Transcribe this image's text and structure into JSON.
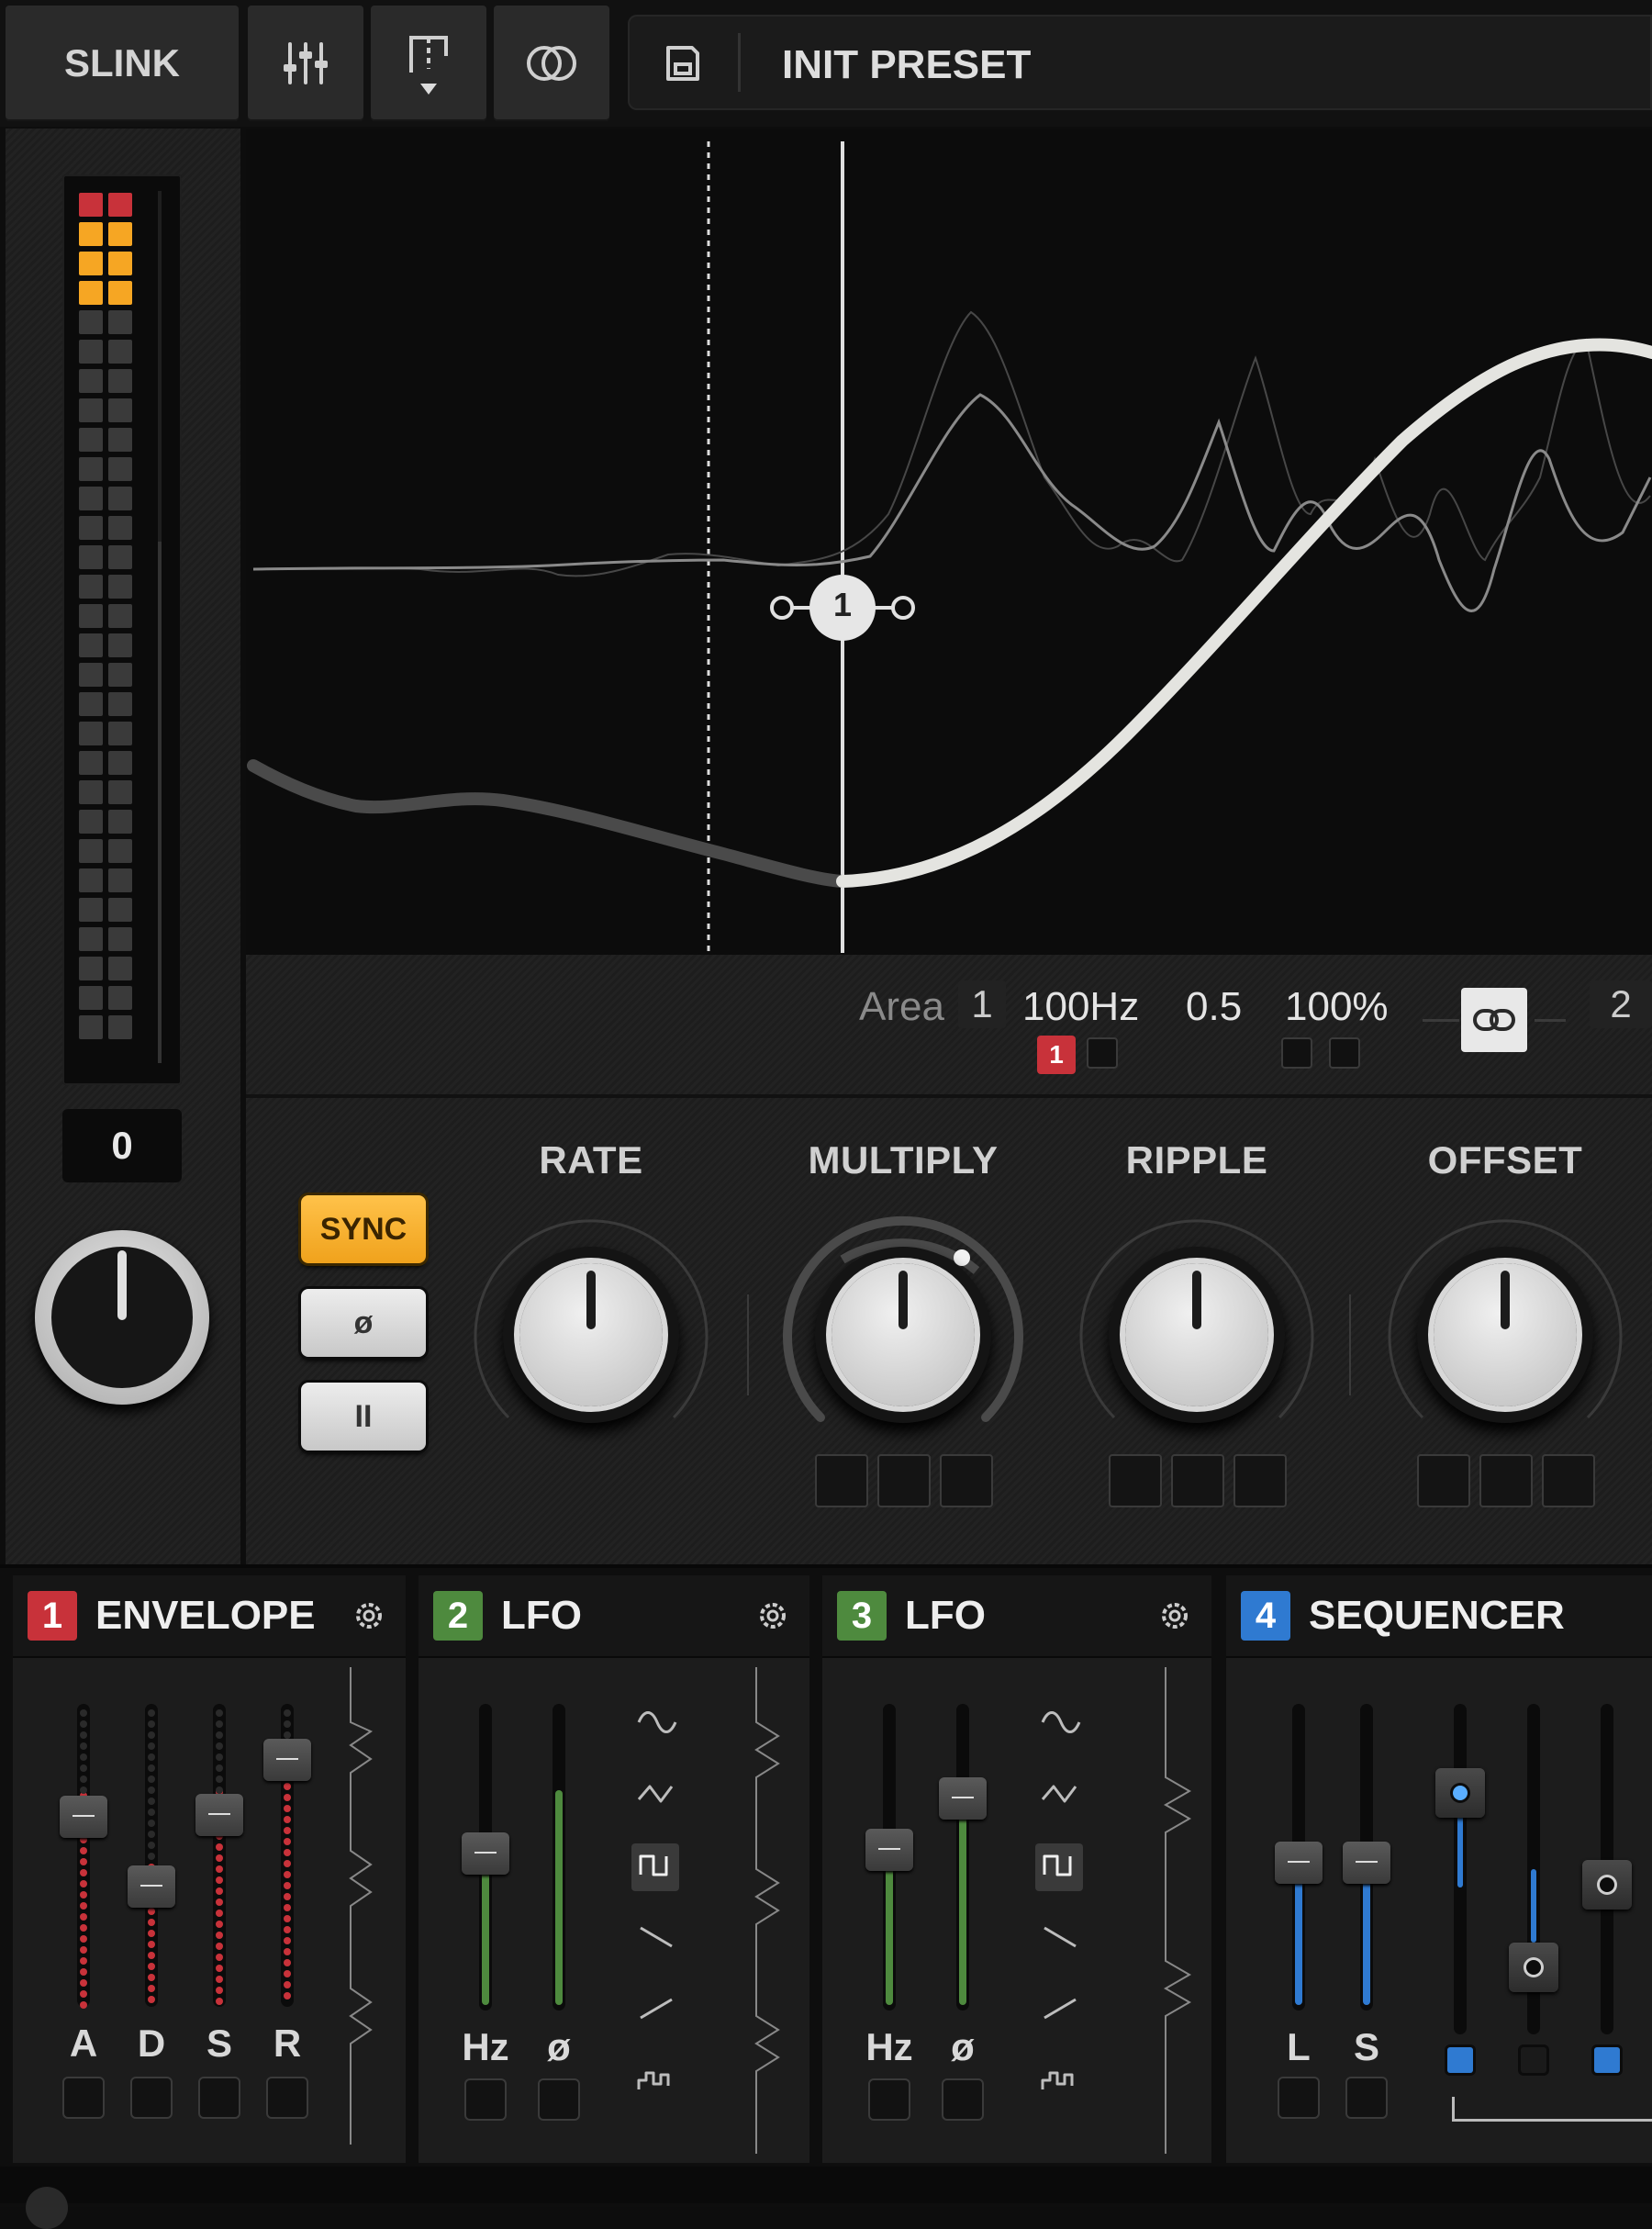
{
  "header": {
    "app_name": "SLINK",
    "preset_name": "INIT PRESET"
  },
  "meter": {
    "value_readout": "0",
    "lit_red_rows": 1,
    "lit_amber_rows": 3,
    "total_rows": 29
  },
  "graph": {
    "node_label": "1"
  },
  "area_bar": {
    "area_label": "Area",
    "area_value": "1",
    "freq": "100Hz",
    "q": "0.5",
    "percent": "100%",
    "mod_badge": "1",
    "right_value": "2"
  },
  "controls": {
    "sync_label": "SYNC",
    "phase_label": "ø",
    "pause_label": "II",
    "knobs": [
      {
        "label": "RATE"
      },
      {
        "label": "MULTIPLY"
      },
      {
        "label": "RIPPLE"
      },
      {
        "label": "OFFSET"
      }
    ]
  },
  "modulators": [
    {
      "number": "1",
      "title": "ENVELOPE",
      "color": "#c8323a",
      "sliders": [
        "A",
        "D",
        "S",
        "R"
      ]
    },
    {
      "number": "2",
      "title": "LFO",
      "color": "#4e8a3e",
      "sliders": [
        "Hz",
        "ø"
      ]
    },
    {
      "number": "3",
      "title": "LFO",
      "color": "#4e8a3e",
      "sliders": [
        "Hz",
        "ø"
      ]
    },
    {
      "number": "4",
      "title": "SEQUENCER",
      "color": "#2f7ad1",
      "sliders": [
        "L",
        "S"
      ]
    }
  ],
  "colors": {
    "sync_amber": "#f6a623",
    "meter_red": "#c8323a",
    "meter_amber": "#f6a623",
    "seq_blue": "#2f7ad1",
    "lfo_green": "#4e8a3e"
  }
}
